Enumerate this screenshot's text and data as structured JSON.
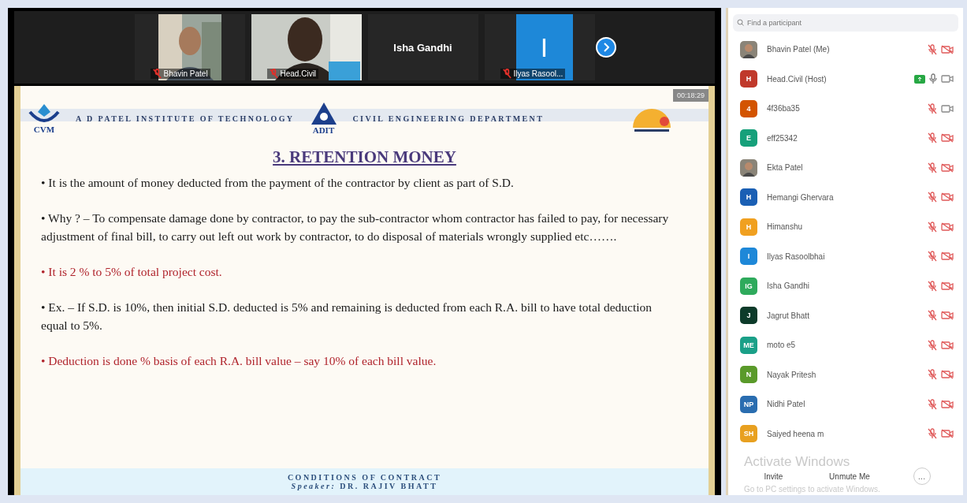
{
  "video_strip": [
    {
      "name": "Bhavin Patel",
      "muted": true
    },
    {
      "name": "Head.Civil",
      "muted": true
    },
    {
      "kind": "name",
      "name": "Isha Gandhi"
    },
    {
      "kind": "initial",
      "initial": "I",
      "name": "Ilyas Rasool...",
      "muted": true
    }
  ],
  "slide": {
    "timer": "00:18:29",
    "left_logo_text": "CVM",
    "institute": "A D PATEL INSTITUTE OF TECHNOLOGY",
    "center_logo_text": "ADIT",
    "department": "CIVIL ENGINEERING DEPARTMENT",
    "title": "3. RETENTION MONEY",
    "bullets": [
      {
        "text": "• It is the amount of money deducted from the payment of the contractor by client as part of S.D.",
        "color": "#1a1a1a"
      },
      {
        "text": "• Why ? – To compensate damage done by contractor, to pay the sub-contractor whom contractor has failed to pay, for necessary adjustment of final bill, to carry out left out work by contractor, to do disposal of materials wrongly supplied etc…….",
        "color": "#1a1a1a"
      },
      {
        "text": "• It is 2 % to 5% of total project cost.",
        "color": "#b0242c"
      },
      {
        "text": "• Ex. – If S.D. is 10%, then initial S.D. deducted is 5% and remaining is deducted from each R.A. bill to have total deduction equal to 5%.",
        "color": "#1a1a1a"
      },
      {
        "text": "• Deduction is done % basis of each R.A. bill value – say 10% of each bill value.",
        "color": "#b0242c"
      }
    ],
    "footer_title": "CONDITIONS OF CONTRACT",
    "footer_speaker_label": "Speaker:",
    "footer_speaker": "DR. RAJIV BHATT"
  },
  "participants_panel": {
    "search": {
      "placeholder": "Find a participant"
    },
    "participants": [
      {
        "name": "Bhavin Patel (Me)",
        "muted": true,
        "video_off": true
      },
      {
        "name": "Head.Civil (Host)",
        "kind": "initials",
        "initials": "H",
        "color": "#c0392b",
        "muted": false,
        "video_off": false,
        "sharing": true
      },
      {
        "name": "4f36ba35",
        "kind": "initials",
        "initials": "4",
        "color": "#d35400",
        "muted": true,
        "video_off": false
      },
      {
        "name": "eff25342",
        "kind": "initials",
        "initials": "E",
        "color": "#16a07a",
        "muted": true,
        "video_off": true
      },
      {
        "name": "Ekta Patel",
        "muted": true,
        "video_off": true
      },
      {
        "name": "Hemangi Ghervara",
        "kind": "initials",
        "initials": "H",
        "color": "#1a5fb4",
        "muted": true,
        "video_off": true
      },
      {
        "name": "Himanshu",
        "kind": "initials",
        "initials": "H",
        "color": "#f0a020",
        "muted": true,
        "video_off": true
      },
      {
        "name": "Ilyas Rasoolbhai",
        "kind": "initials",
        "initials": "I",
        "color": "#1e88d8",
        "muted": true,
        "video_off": true
      },
      {
        "name": "Isha Gandhi",
        "kind": "initials",
        "initials": "IG",
        "color": "#2eaa5c",
        "muted": true,
        "video_off": true
      },
      {
        "name": "Jagrut Bhatt",
        "kind": "initials",
        "initials": "J",
        "color": "#0d3b2a",
        "muted": true,
        "video_off": true
      },
      {
        "name": "moto e5",
        "kind": "initials",
        "initials": "ME",
        "color": "#1aa088",
        "muted": true,
        "video_off": true
      },
      {
        "name": "Nayak Pritesh",
        "kind": "initials",
        "initials": "N",
        "color": "#5a9a2a",
        "muted": true,
        "video_off": true
      },
      {
        "name": "Nidhi Patel",
        "kind": "initials",
        "initials": "NP",
        "color": "#2a6db0",
        "muted": true,
        "video_off": true
      },
      {
        "name": "Saiyed heena m",
        "kind": "initials",
        "initials": "SH",
        "color": "#e8a020",
        "muted": true,
        "video_off": true
      }
    ],
    "os_notice": {
      "title": "Activate Windows",
      "subtitle": "Go to PC settings to activate Windows."
    },
    "buttons": [
      "Invite",
      "Unmute Me"
    ],
    "more_button": "…"
  }
}
